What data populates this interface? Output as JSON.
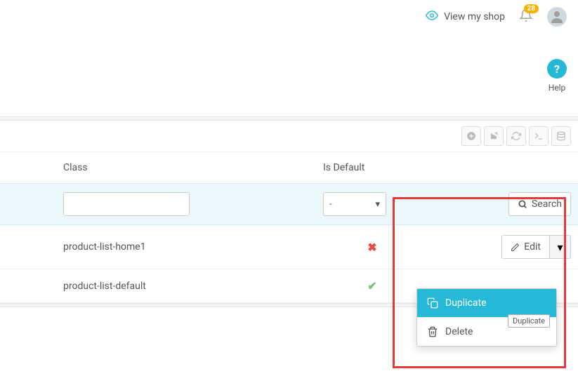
{
  "topbar": {
    "view_shop_label": "View my shop",
    "notifications_count": "28"
  },
  "help": {
    "label": "Help"
  },
  "table": {
    "col_class": "Class",
    "col_default": "Is Default",
    "filter_select_value": "-",
    "search_label": "Search"
  },
  "rows": [
    {
      "class": "product-list-home1",
      "is_default": false,
      "edit_label": "Edit"
    },
    {
      "class": "product-list-default",
      "is_default": true
    }
  ],
  "dropdown": {
    "duplicate": "Duplicate",
    "delete": "Delete"
  },
  "tooltip": "Duplicate"
}
